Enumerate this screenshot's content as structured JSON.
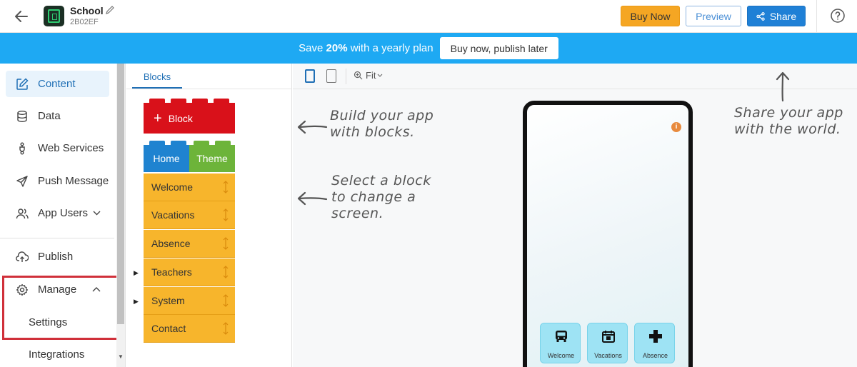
{
  "header": {
    "app_name": "School",
    "app_code": "2B02EF",
    "buy_now": "Buy Now",
    "preview": "Preview",
    "share": "Share"
  },
  "promo": {
    "text_before": "Save ",
    "text_bold": "20%",
    "text_after": " with a yearly plan",
    "button": "Buy now, publish later"
  },
  "sidebar": {
    "items": [
      {
        "label": "Content",
        "icon": "edit-icon"
      },
      {
        "label": "Data",
        "icon": "database-icon"
      },
      {
        "label": "Web Services",
        "icon": "plug-icon"
      },
      {
        "label": "Push Message",
        "icon": "send-icon"
      },
      {
        "label": "App Users",
        "icon": "users-icon"
      },
      {
        "label": "Publish",
        "icon": "cloud-upload-icon"
      },
      {
        "label": "Manage",
        "icon": "gear-icon"
      }
    ],
    "sub_items": [
      "Settings",
      "Integrations"
    ]
  },
  "blocks": {
    "tab": "Blocks",
    "add_block": "Block",
    "home": "Home",
    "theme": "Theme",
    "screens": [
      "Welcome",
      "Vacations",
      "Absence",
      "Teachers",
      "System",
      "Contact"
    ]
  },
  "canvas": {
    "fit_label": "Fit",
    "hint_build": [
      "Build your app",
      "with blocks."
    ],
    "hint_select": [
      "Select a block",
      "to change a",
      "screen."
    ],
    "hint_share": [
      "Share your app",
      "with the world."
    ]
  },
  "phone": {
    "tiles": [
      {
        "label": "Welcome",
        "icon": "school-bus-icon"
      },
      {
        "label": "Vacations",
        "icon": "calendar-icon"
      },
      {
        "label": "Absence",
        "icon": "medical-cross-icon"
      }
    ]
  },
  "colors": {
    "promo_bg": "#1ea9f3",
    "buy_now_bg": "#f5a623",
    "share_bg": "#1f80d6",
    "add_block": "#d9111a",
    "home_block": "#1f83d0",
    "theme_block": "#6db43a",
    "screen_block": "#f7b52c",
    "highlight_box": "#d0303a",
    "tile_bg": "#9ee3f4"
  }
}
